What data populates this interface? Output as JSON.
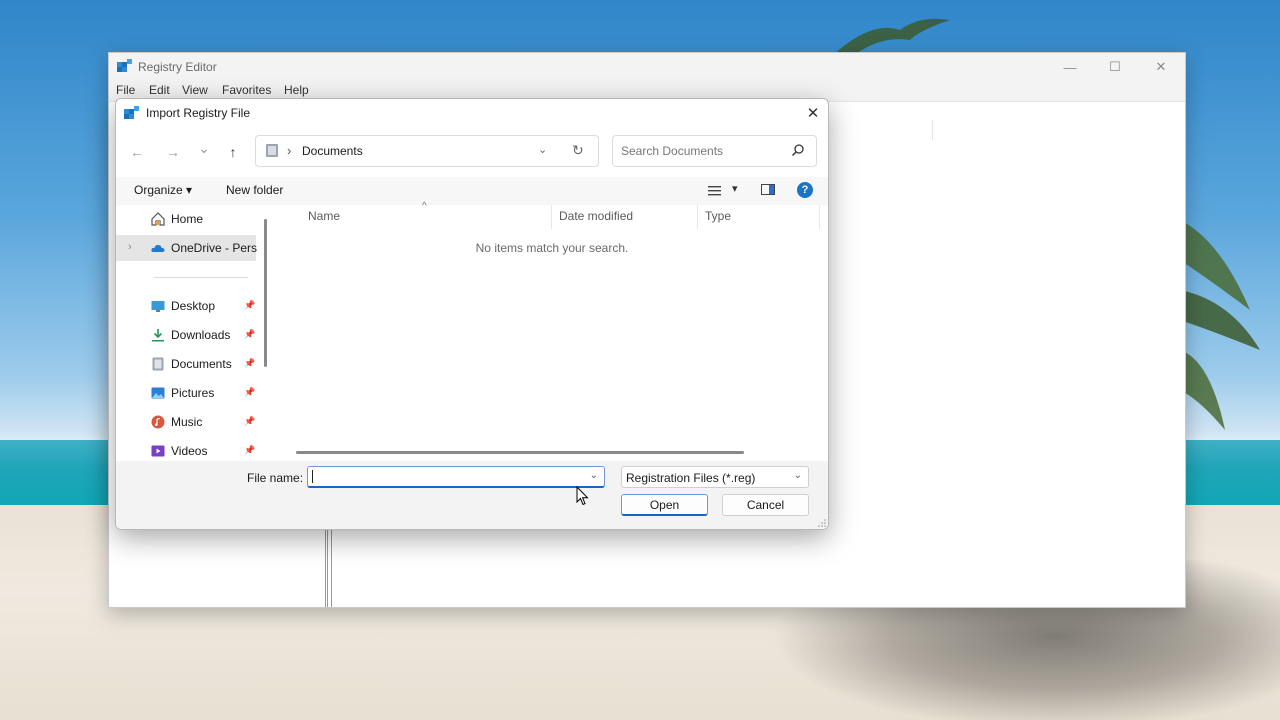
{
  "regedit": {
    "title": "Registry Editor",
    "menu": [
      "File",
      "Edit",
      "View",
      "Favorites",
      "Help"
    ],
    "controls": {
      "minimize": "—",
      "maximize": "☐",
      "close": "✕"
    }
  },
  "dialog": {
    "title": "Import Registry File",
    "close_glyph": "✕",
    "nav": {
      "back": "←",
      "forward": "→",
      "recent": "⌄",
      "up": "↑"
    },
    "address": {
      "separator": "›",
      "crumb": "Documents",
      "dropdown": "⌄",
      "refresh": "↻"
    },
    "search_placeholder": "Search Documents",
    "commandbar": {
      "organize": "Organize ▾",
      "new_folder": "New folder",
      "view_dropdown": "▾",
      "help": "?"
    },
    "navpane": {
      "items": [
        {
          "label": "Home",
          "icon": "home-icon",
          "pinned": false
        },
        {
          "label": "OneDrive - Pers",
          "icon": "onedrive-icon",
          "pinned": false,
          "selected": true,
          "expand": "›"
        },
        {
          "label": "Desktop",
          "icon": "desktop-icon",
          "pinned": true
        },
        {
          "label": "Downloads",
          "icon": "download-icon",
          "pinned": true
        },
        {
          "label": "Documents",
          "icon": "documents-icon",
          "pinned": true
        },
        {
          "label": "Pictures",
          "icon": "pictures-icon",
          "pinned": true
        },
        {
          "label": "Music",
          "icon": "music-icon",
          "pinned": true
        },
        {
          "label": "Videos",
          "icon": "videos-icon",
          "pinned": true
        }
      ]
    },
    "filelist": {
      "columns": [
        "Name",
        "Date modified",
        "Type"
      ],
      "sort_glyph": "^",
      "empty_message": "No items match your search."
    },
    "footer": {
      "file_name_label": "File name:",
      "file_name_value": "",
      "file_type": "Registration Files (*.reg)",
      "dropdown_glyph": "⌄",
      "open_label": "Open",
      "cancel_label": "Cancel"
    }
  },
  "colors": {
    "accent": "#1a67c0",
    "selection": "#e5e5e5"
  }
}
